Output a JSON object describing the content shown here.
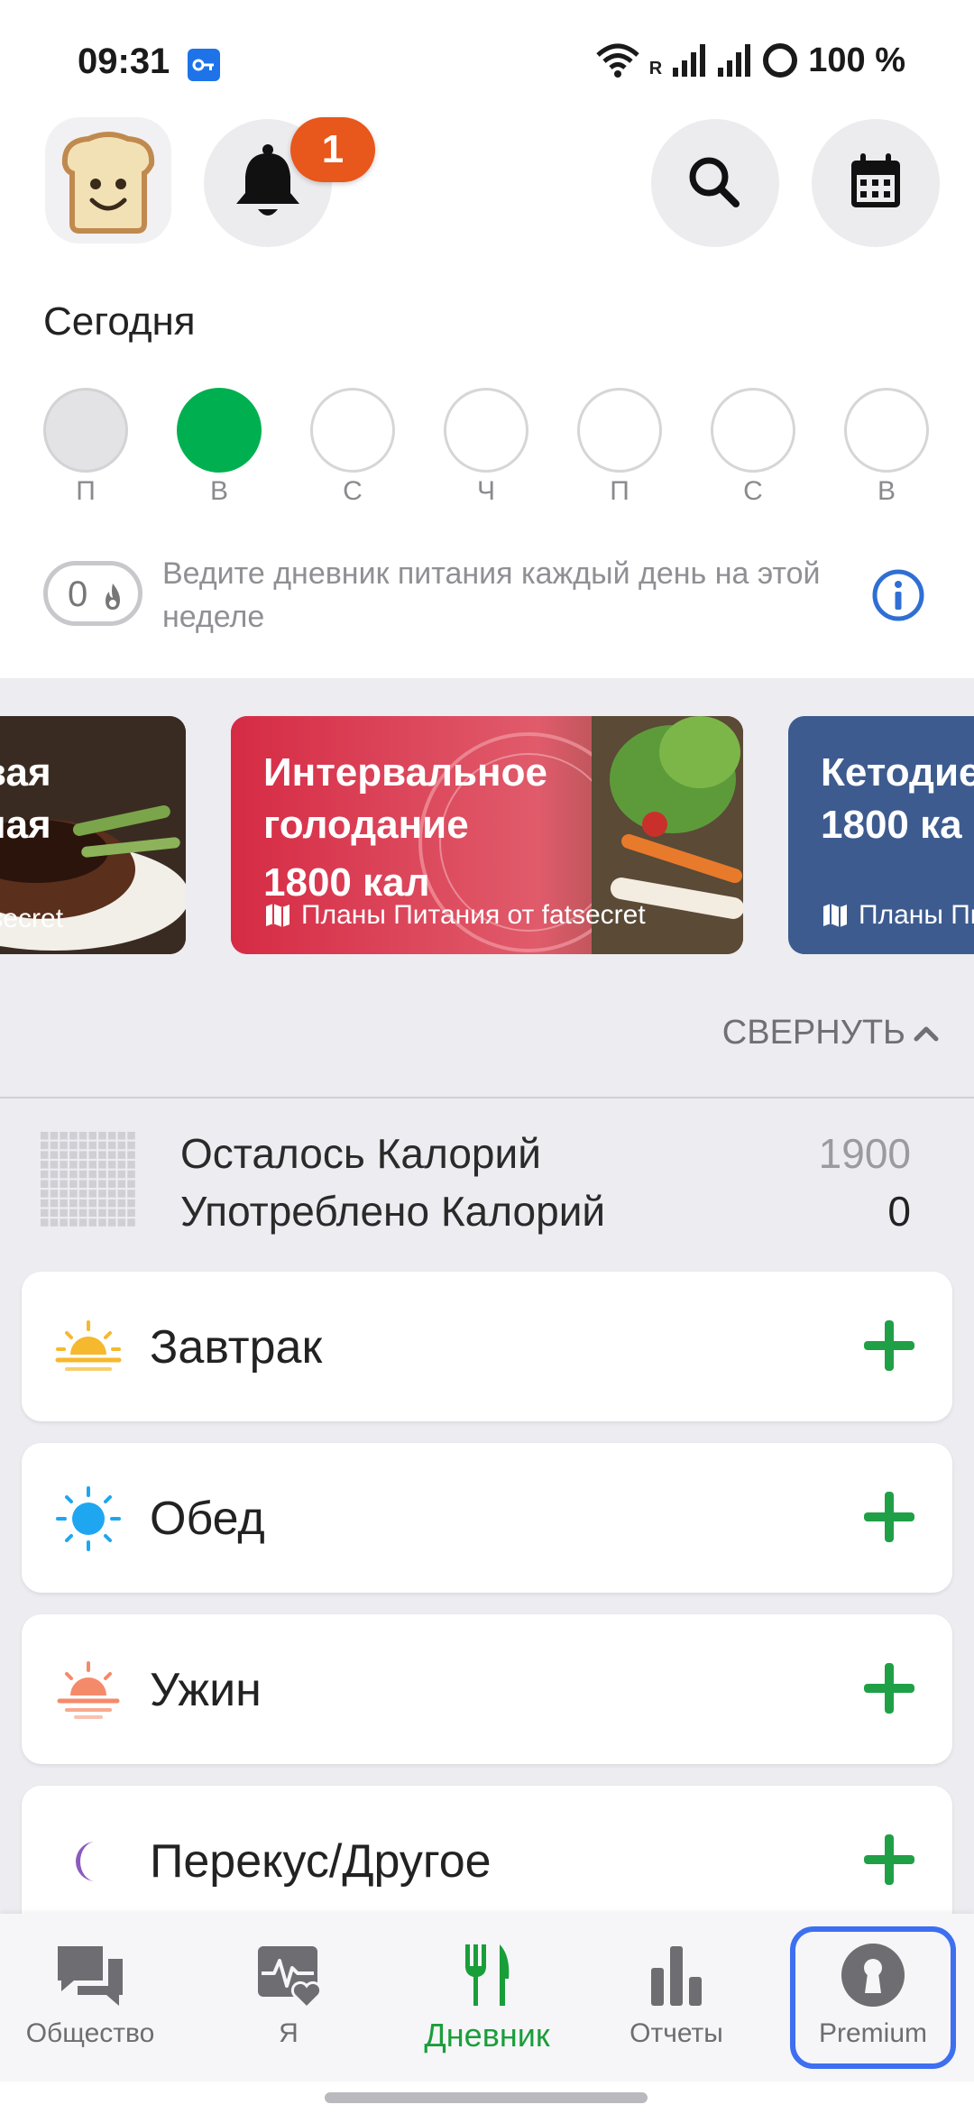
{
  "status_bar": {
    "time": "09:31",
    "network_type": "R",
    "battery": "100 %"
  },
  "header": {
    "notification_count": "1"
  },
  "week": {
    "title": "Сегодня",
    "days": [
      "П",
      "В",
      "С",
      "Ч",
      "П",
      "С",
      "В"
    ],
    "streak_count": "0",
    "streak_text": "Ведите дневник питания каждый день на этой неделе"
  },
  "banners": [
    {
      "title_lines": [
        "вая",
        "ная"
      ],
      "subtitle": "tsecret",
      "color": "#3c2a22"
    },
    {
      "title_lines": [
        "Интервальное",
        "голодание",
        "1800 кал"
      ],
      "subtitle": "Планы Питания от fatsecret",
      "color": "#d8324a"
    },
    {
      "title_lines": [
        "Кетодие",
        "1800 ка"
      ],
      "subtitle": "Планы Пи",
      "color": "#3d5b8f"
    }
  ],
  "collapse_label": "СВЕРНУТЬ",
  "calories": {
    "remaining_label": "Осталось Калорий",
    "remaining_value": "1900",
    "consumed_label": "Употреблено Калорий",
    "consumed_value": "0"
  },
  "meals": [
    {
      "name": "Завтрак",
      "icon": "sunrise-icon"
    },
    {
      "name": "Обед",
      "icon": "sun-icon"
    },
    {
      "name": "Ужин",
      "icon": "sunset-icon"
    },
    {
      "name": "Перекус/Другое",
      "icon": "moon-icon"
    }
  ],
  "nav": {
    "items": [
      {
        "label": "Общество",
        "icon": "chat-icon"
      },
      {
        "label": "Я",
        "icon": "activity-icon"
      },
      {
        "label": "Дневник",
        "icon": "utensils-icon"
      },
      {
        "label": "Отчеты",
        "icon": "bar-chart-icon"
      },
      {
        "label": "Premium",
        "icon": "keyhole-icon"
      }
    ],
    "active": "Дневник"
  },
  "colors": {
    "accent_green": "#00b050",
    "badge_orange": "#e8571b",
    "premium_highlight": "#3d6ff0",
    "info_blue": "#2f6fd4"
  }
}
